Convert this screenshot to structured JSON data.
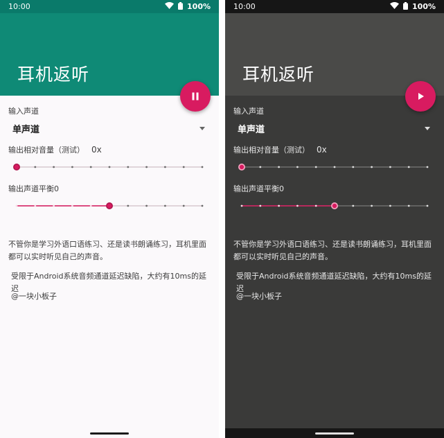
{
  "screens": [
    {
      "theme": "light",
      "status": {
        "time": "10:00",
        "battery": "100%"
      },
      "app_title": "耳机返听",
      "fab_state": "pause",
      "input_channel": {
        "label": "输入声道",
        "value": "单声道"
      },
      "volume": {
        "label": "输出相对音量（测试）",
        "value_text": "0x",
        "fraction": 0.0
      },
      "balance": {
        "label": "输出声道平衡0",
        "fraction": 0.5
      },
      "descriptions": [
        "不管你是学习外语口语练习、还是读书朗诵练习，耳机里面都可以实时听见自己的声音。",
        "受限于Android系统音频通道延迟缺陷，大约有10ms的延迟",
        "@一块小板子"
      ]
    },
    {
      "theme": "dark",
      "status": {
        "time": "10:00",
        "battery": "100%"
      },
      "app_title": "耳机返听",
      "fab_state": "play",
      "input_channel": {
        "label": "输入声道",
        "value": "单声道"
      },
      "volume": {
        "label": "输出相对音量（测试）",
        "value_text": "0x",
        "fraction": 0.0
      },
      "balance": {
        "label": "输出声道平衡0",
        "fraction": 0.5
      },
      "descriptions": [
        "不管你是学习外语口语练习、还是读书朗诵练习，耳机里面都可以实时听见自己的声音。",
        "受限于Android系统音频通道延迟缺陷，大约有10ms的延迟",
        "@一块小板子"
      ]
    }
  ],
  "colors": {
    "accent": "#d81b60",
    "light_primary": "#0f8a76",
    "light_status": "#0a7a6a",
    "dark_appbar": "#4a4a48",
    "dark_background": "#3a3a39"
  },
  "icons": {
    "wifi": "wifi-icon",
    "battery": "battery-icon",
    "pause": "pause-icon",
    "play": "play-icon",
    "dropdown": "dropdown-arrow-icon"
  }
}
